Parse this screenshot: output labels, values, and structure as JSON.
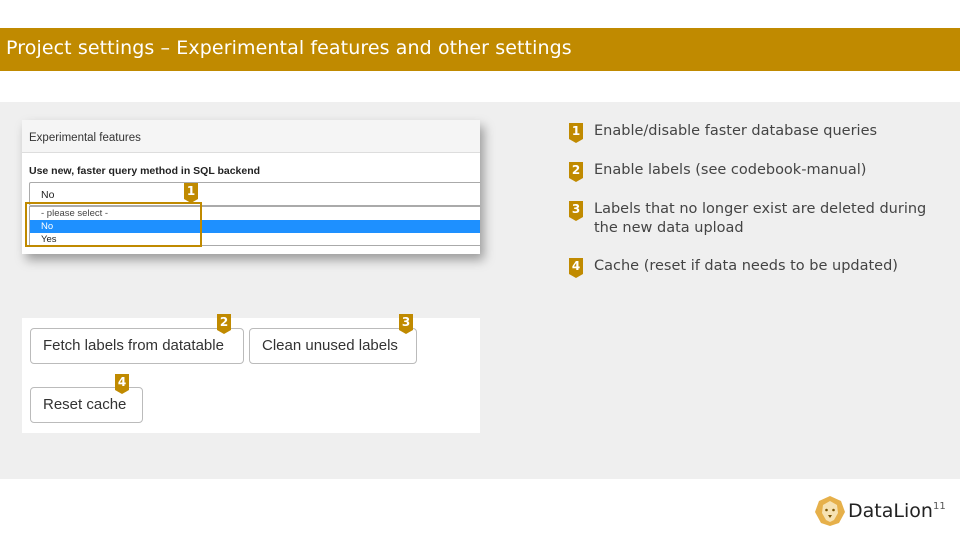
{
  "slide": {
    "title": "Project settings – Experimental features and other settings",
    "page_number": "11"
  },
  "experimental_panel": {
    "header": "Experimental features",
    "label": "Use new, faster query method in SQL backend",
    "select_value": "No",
    "options": [
      "- please select -",
      "No",
      "Yes"
    ],
    "highlighted_option": "No"
  },
  "buttons": {
    "fetch_labels": "Fetch labels from datatable",
    "clean_labels": "Clean unused labels",
    "reset_cache": "Reset cache"
  },
  "badges": [
    "1",
    "2",
    "3",
    "4"
  ],
  "legend": [
    {
      "number": "1",
      "text": "Enable/disable faster database queries"
    },
    {
      "number": "2",
      "text": "Enable labels (see codebook-manual)"
    },
    {
      "number": "3",
      "text": "Labels that no longer exist are deleted during the new data upload"
    },
    {
      "number": "4",
      "text": "Cache (reset if data needs to be updated)"
    }
  ],
  "logo": {
    "icon": "lion-icon",
    "text": "DataLion"
  },
  "colors": {
    "accent": "#c08a00",
    "selected_option": "#1e90ff",
    "background": "#efefef"
  }
}
